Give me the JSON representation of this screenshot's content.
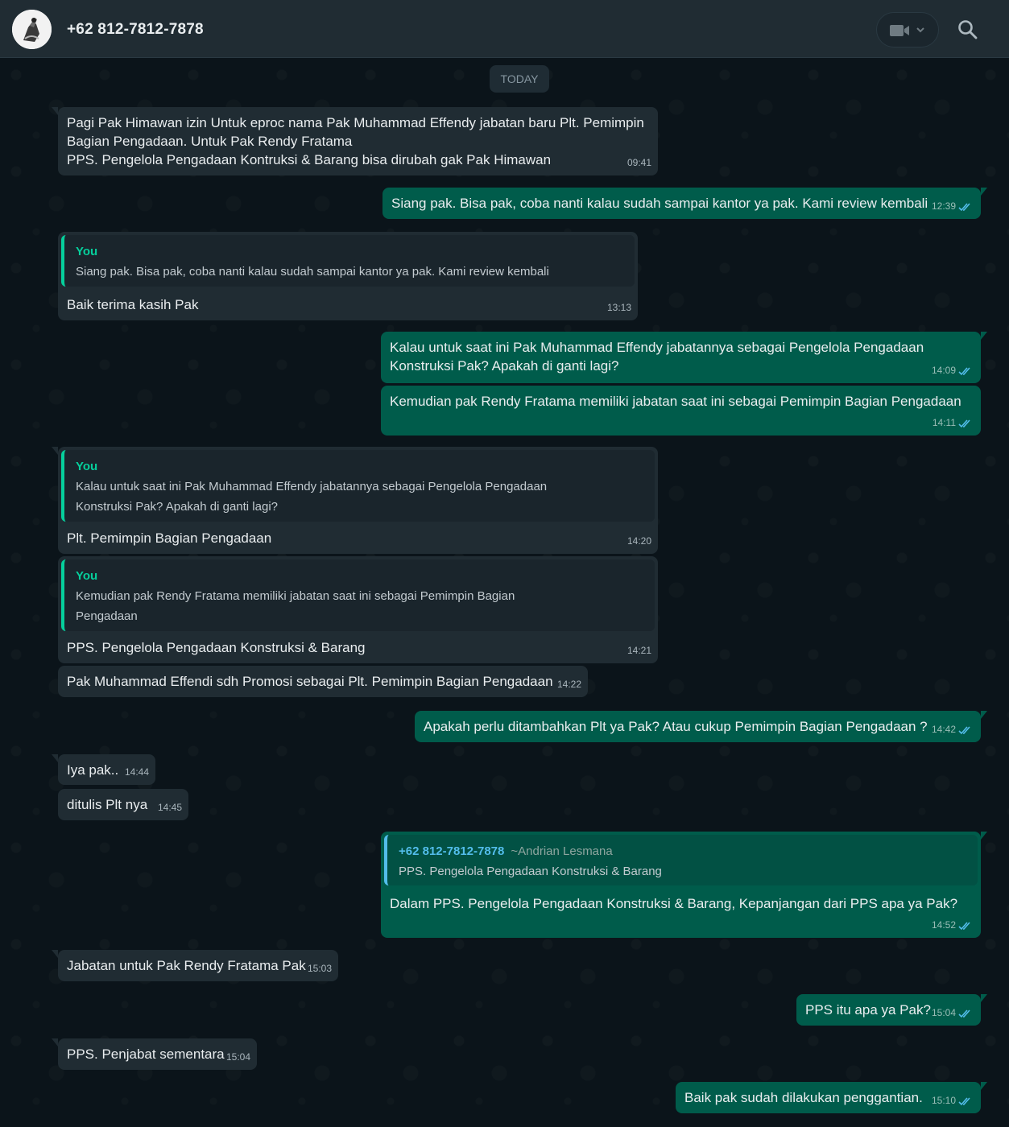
{
  "header": {
    "contact": "+62 812-7812-7878"
  },
  "day_chip": "TODAY",
  "messages": [
    {
      "text": "Pagi Pak Himawan izin Untuk eproc nama Pak Muhammad Effendy jabatan baru Plt. Pemimpin\nBagian Pengadaan. Untuk Pak Rendy Fratama\nPPS. Pengelola Pengadaan Kontruksi & Barang bisa dirubah gak Pak Himawan",
      "time": "09:41"
    },
    {
      "text": "Siang pak. Bisa pak, coba nanti kalau sudah sampai kantor ya pak. Kami review kembali",
      "time": "12:39"
    },
    {
      "quote_author": "You",
      "quote_text": "Siang pak. Bisa pak, coba nanti kalau sudah sampai kantor ya pak. Kami review kembali",
      "text": "Baik terima kasih Pak",
      "time": "13:13"
    },
    {
      "text": "Kalau untuk saat ini Pak Muhammad Effendy jabatannya sebagai Pengelola Pengadaan\nKonstruksi Pak? Apakah di ganti lagi?",
      "time": "14:09"
    },
    {
      "text": "Kemudian pak Rendy Fratama memiliki jabatan saat ini sebagai Pemimpin Bagian Pengadaan",
      "time": "14:11"
    },
    {
      "quote_author": "You",
      "quote_text": "Kalau untuk saat ini Pak Muhammad Effendy jabatannya sebagai Pengelola Pengadaan\nKonstruksi Pak? Apakah di ganti lagi?",
      "text": "Plt. Pemimpin Bagian Pengadaan",
      "time": "14:20"
    },
    {
      "quote_author": "You",
      "quote_text": "Kemudian pak Rendy Fratama memiliki jabatan saat ini sebagai Pemimpin Bagian\nPengadaan",
      "text": "PPS. Pengelola Pengadaan Konstruksi & Barang",
      "time": "14:21"
    },
    {
      "text": "Pak Muhammad Effendi sdh Promosi sebagai Plt. Pemimpin Bagian Pengadaan",
      "time": "14:22"
    },
    {
      "text": "Apakah perlu ditambahkan Plt ya Pak? Atau cukup Pemimpin Bagian Pengadaan ?",
      "time": "14:42"
    },
    {
      "text": "Iya pak..",
      "time": "14:44"
    },
    {
      "text": "ditulis Plt nya",
      "time": "14:45"
    },
    {
      "quote_author": "+62 812-7812-7878",
      "quote_pushname": "~Andrian Lesmana",
      "quote_text": "PPS. Pengelola Pengadaan Konstruksi & Barang",
      "text": "Dalam PPS. Pengelola Pengadaan Konstruksi & Barang, Kepanjangan dari PPS apa ya Pak?",
      "time": "14:52"
    },
    {
      "text": "Jabatan untuk Pak Rendy Fratama Pak",
      "time": "15:03"
    },
    {
      "text": "PPS itu apa ya Pak?",
      "time": "15:04"
    },
    {
      "text": "PPS. Penjabat sementara",
      "time": "15:04"
    },
    {
      "text": "Baik pak sudah dilakukan penggantian.",
      "time": "15:10"
    }
  ]
}
